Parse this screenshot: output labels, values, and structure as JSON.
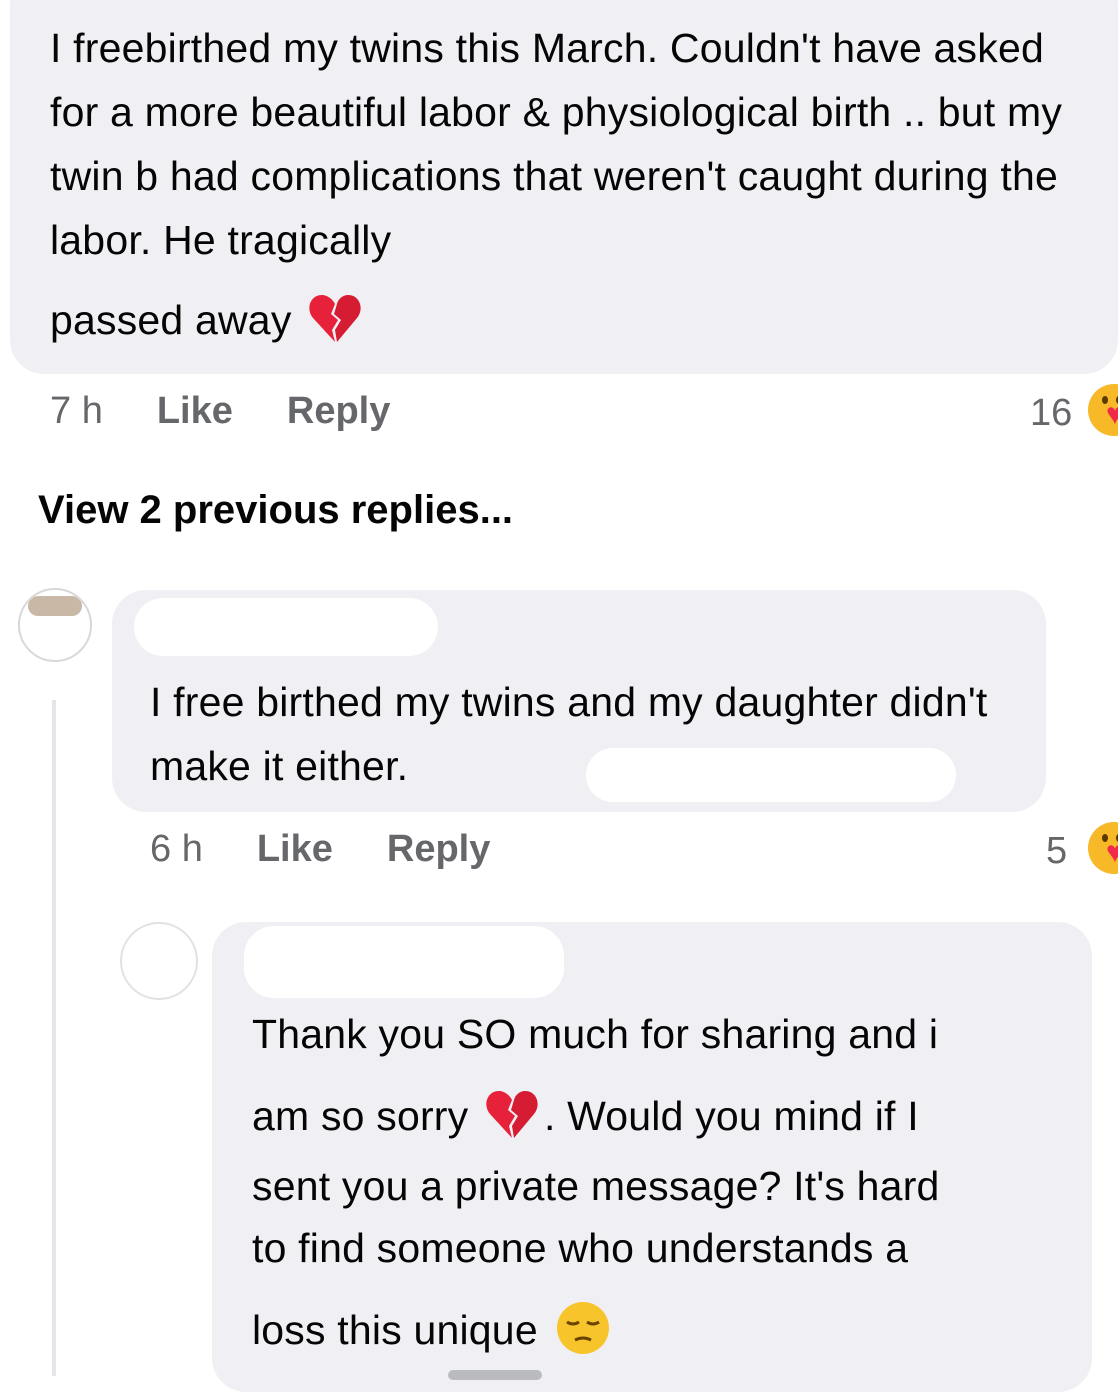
{
  "comment1": {
    "text": "I freebirthed my twins this March. Couldn't have asked for a more beautiful labor & physiological birth .. but my twin b had complications that weren't caught during the labor. He tragically",
    "text_end": "passed away",
    "emoji": "broken-heart-icon",
    "time": "7 h",
    "like_label": "Like",
    "reply_label": "Reply",
    "reaction_count": "16",
    "reaction_icon": "hugging-face-icon"
  },
  "view_previous": "View 2 previous replies...",
  "reply1": {
    "text": "I free birthed my twins and my daughter didn't make it either.",
    "time": "6 h",
    "like_label": "Like",
    "reply_label": "Reply",
    "reaction_count": "5",
    "reaction_icon": "hugging-face-icon"
  },
  "reply2": {
    "line1": "Thank you SO much for sharing and i",
    "line2a": "am so sorry",
    "line2b": ". Would you mind if I",
    "line3": "sent you a private message? It's hard",
    "line4": "to find someone who understands a",
    "line5": "loss this unique",
    "emojis": [
      "broken-heart-icon",
      "pensive-face-icon"
    ]
  },
  "colors": {
    "bubble": "#f0f0f4",
    "meta": "#65676b",
    "text": "#050505",
    "heart": "#e8213a",
    "reaction": "#f7b928"
  }
}
